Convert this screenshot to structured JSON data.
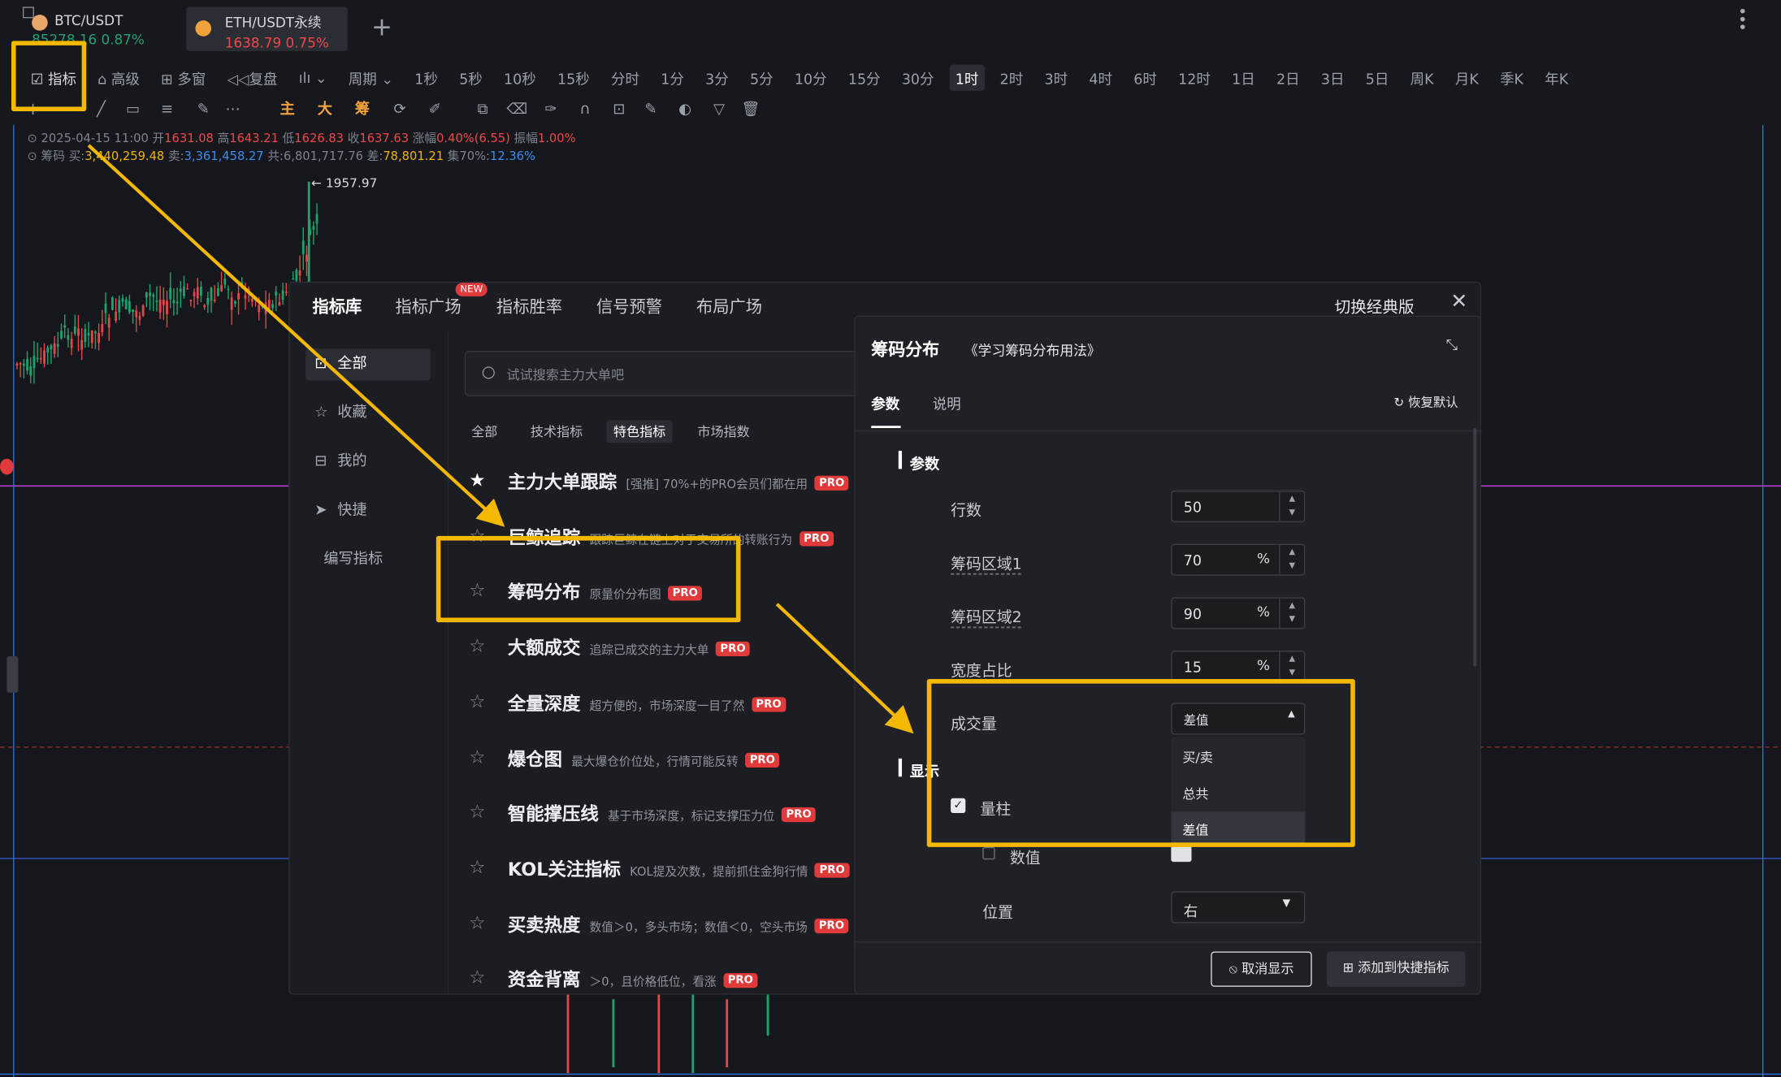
{
  "tabs": [
    {
      "name": "BTC/USDT",
      "price": "85278.16",
      "change": "0.87%"
    },
    {
      "name": "ETH/USDT永续",
      "price": "1638.79",
      "change": "0.75%"
    }
  ],
  "toolbar": {
    "indicator": "指标",
    "advanced": "高级",
    "multi": "多窗",
    "replay": "复盘",
    "period": "周期"
  },
  "timeframes": [
    "1秒",
    "5秒",
    "10秒",
    "15秒",
    "分时",
    "1分",
    "3分",
    "5分",
    "10分",
    "15分",
    "30分",
    "1时",
    "2时",
    "3时",
    "4时",
    "6时",
    "12时",
    "1日",
    "2日",
    "3日",
    "5日",
    "周K",
    "月K",
    "季K",
    "年K"
  ],
  "selected_timeframe": "1时",
  "draw_labels": {
    "main": "主",
    "big": "大",
    "chips": "筹"
  },
  "ohlc_line": {
    "date": "2025-04-15 11:00",
    "open_l": "开",
    "open": "1631.08",
    "high_l": "高",
    "high": "1643.21",
    "low_l": "低",
    "low": "1626.83",
    "close_l": "收",
    "close": "1637.63",
    "chg_l": "涨幅",
    "chg": "0.40%(6.55)",
    "amp_l": "振幅",
    "amp": "1.00%"
  },
  "chip_line": {
    "label": "筹码",
    "buy_l": "买:",
    "buy": "3,440,259.48",
    "sell_l": "卖:",
    "sell": "3,361,458.27",
    "total_l": "共:",
    "total": "6,801,717.76",
    "diff_l": "差:",
    "diff": "78,801.21",
    "conc_l": "集70%:",
    "conc": "12.36%"
  },
  "price_marker": "← 1957.97",
  "panel": {
    "tabs": [
      "指标库",
      "指标广场",
      "指标胜率",
      "信号预警",
      "布局广场"
    ],
    "new_badge": "NEW",
    "switch_classic": "切换经典版",
    "side": [
      "全部",
      "收藏",
      "我的",
      "快捷",
      "编写指标"
    ],
    "search_placeholder": "试试搜索主力大单吧",
    "filters": [
      "全部",
      "技术指标",
      "特色指标",
      "市场指数"
    ],
    "items": [
      {
        "title": "主力大单跟踪",
        "desc": "[强推] 70%+的PRO会员们都在用"
      },
      {
        "title": "巨鲸追踪",
        "desc": "跟踪巨鲸在链上对于交易所的转账行为"
      },
      {
        "title": "筹码分布",
        "desc": "原量价分布图"
      },
      {
        "title": "大额成交",
        "desc": "追踪已成交的主力大单"
      },
      {
        "title": "全量深度",
        "desc": "超方便的，市场深度一目了然"
      },
      {
        "title": "爆仓图",
        "desc": "最大爆仓价位处，行情可能反转"
      },
      {
        "title": "智能撑压线",
        "desc": "基于市场深度，标记支撑压力位"
      },
      {
        "title": "KOL关注指标",
        "desc": "KOL提及次数，提前抓住金狗行情"
      },
      {
        "title": "买卖热度",
        "desc": "数值＞0，多头市场；数值＜0，空头市场"
      },
      {
        "title": "资金背离",
        "desc": "＞0，且价格低位，看涨"
      }
    ],
    "pro": "PRO"
  },
  "detail": {
    "title": "筹码分布",
    "link": "《学习筹码分布用法》",
    "tab_params": "参数",
    "tab_desc": "说明",
    "reset": "恢复默认",
    "section_params": "参数",
    "rows_label": "行数",
    "rows_value": "50",
    "zone1_label": "筹码区域1",
    "zone1_value": "70",
    "zone2_label": "筹码区域2",
    "zone2_value": "90",
    "width_label": "宽度占比",
    "width_value": "15",
    "pct": "%",
    "volume_label": "成交量",
    "volume_value": "差值",
    "volume_options": [
      "买/卖",
      "总共",
      "差值"
    ],
    "section_display": "显示",
    "bar_label": "量柱",
    "value_label": "数值",
    "position_label": "位置",
    "position_value": "右",
    "cancel": "取消显示",
    "add_quick": "添加到快捷指标"
  }
}
